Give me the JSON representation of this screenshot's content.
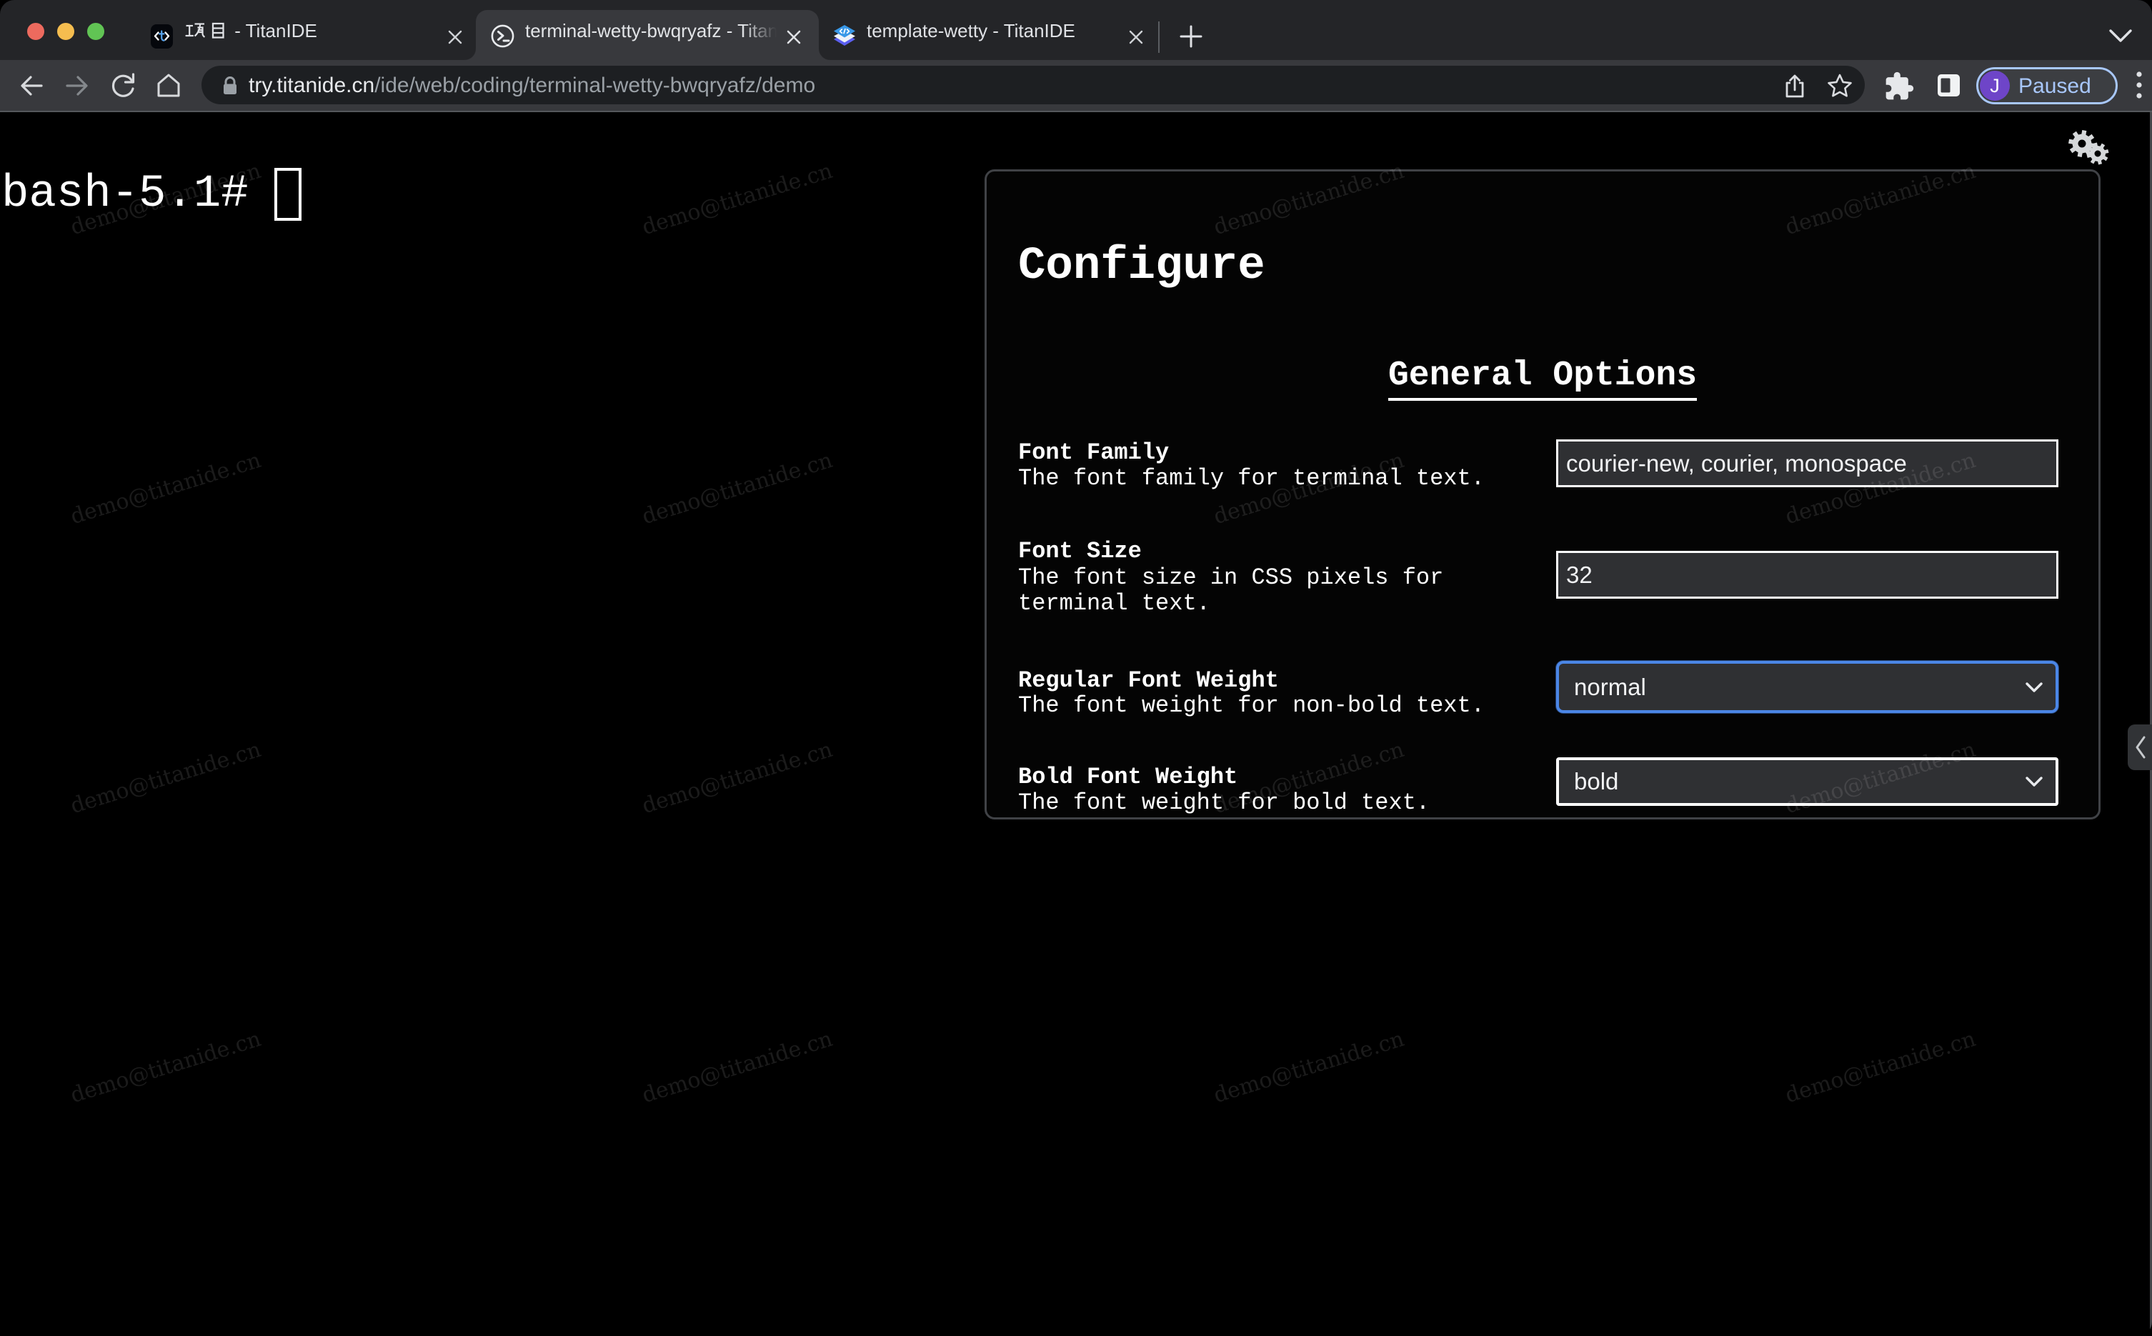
{
  "browser": {
    "traffic_lights": {
      "close": "#ed6a5e",
      "minimize": "#f5bd4f",
      "zoom": "#61c454"
    },
    "tabs": [
      {
        "title": "项目 - TitanIDE",
        "title_suffix": " - TitanIDE",
        "active": false
      },
      {
        "title": "terminal-wetty-bwqryafz - TitanIDE",
        "active": true
      },
      {
        "title": "template-wetty - TitanIDE",
        "active": false
      }
    ],
    "toolbar": {
      "url_domain": "try.titanide.cn",
      "url_path": "/ide/web/coding/terminal-wetty-bwqryafz/demo",
      "profile": {
        "initial": "J",
        "status": "Paused"
      }
    }
  },
  "terminal": {
    "prompt": "bash-5.1#"
  },
  "watermark": {
    "text": "demo@titanide.cn",
    "grid_x": [
      232,
      1032,
      1832,
      2632
    ],
    "grid_y": [
      122,
      527,
      932,
      1337
    ]
  },
  "settings_panel": {
    "title": "Configure",
    "section": "General Options",
    "fields": [
      {
        "label": "Font Family",
        "description": "The font family for terminal text.",
        "type": "text",
        "value": "courier-new, courier, monospace"
      },
      {
        "label": "Font Size",
        "description": "The font size in CSS pixels for terminal text.",
        "type": "text",
        "value": "32"
      },
      {
        "label": "Regular Font Weight",
        "description": "The font weight for non-bold text.",
        "type": "select",
        "value": "normal",
        "focused": true
      },
      {
        "label": "Bold Font Weight",
        "description": "The font weight for bold text.",
        "type": "select",
        "value": "bold",
        "focused": false
      }
    ]
  },
  "colors": {
    "frame": "#242528",
    "toolbar": "#38393d",
    "omnibox": "#1d1f22",
    "accent_focus": "#4b86e6",
    "profile_badge": "#a8c7fa",
    "avatar": "#6e45c8",
    "terminal_bg": "#000000",
    "panel_border": "#404246"
  }
}
